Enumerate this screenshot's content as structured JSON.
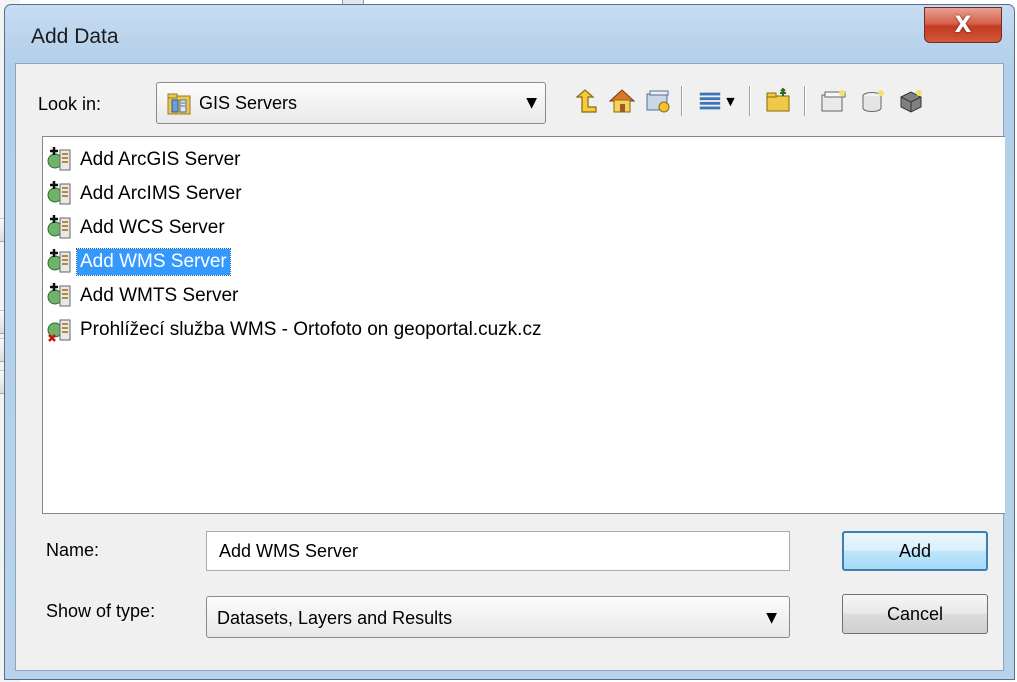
{
  "dialog": {
    "title": "Add Data",
    "close_glyph": "X"
  },
  "look_in": {
    "label": "Look in:",
    "value": "GIS Servers",
    "icon": "gis-servers-folder-icon"
  },
  "toolbar": {
    "buttons": [
      {
        "name": "up-one-level-icon"
      },
      {
        "name": "home-icon"
      },
      {
        "name": "connect-to-folder-icon"
      },
      {
        "name": "view-list-icon"
      },
      {
        "name": "new-folder-icon"
      },
      {
        "name": "new-item-icon"
      },
      {
        "name": "new-geodatabase-icon"
      },
      {
        "name": "new-server-icon"
      }
    ]
  },
  "files": [
    {
      "label": "Add ArcGIS Server",
      "icon": "add-server-icon",
      "selected": false
    },
    {
      "label": "Add ArcIMS Server",
      "icon": "add-server-icon",
      "selected": false
    },
    {
      "label": "Add WCS Server",
      "icon": "add-server-icon",
      "selected": false
    },
    {
      "label": "Add WMS Server",
      "icon": "add-server-icon",
      "selected": true
    },
    {
      "label": "Add WMTS Server",
      "icon": "add-server-icon",
      "selected": false
    },
    {
      "label": "Prohlížecí služba WMS - Ortofoto on geoportal.cuzk.cz",
      "icon": "server-disconnected-icon",
      "selected": false
    }
  ],
  "name_field": {
    "label": "Name:",
    "value": "Add WMS Server"
  },
  "type_field": {
    "label": "Show of type:",
    "value": "Datasets, Layers and Results"
  },
  "buttons": {
    "add": "Add",
    "cancel": "Cancel"
  },
  "colors": {
    "selection": "#3399ff",
    "title_gradient": "#b3cfe9",
    "close": "#c23a21"
  }
}
